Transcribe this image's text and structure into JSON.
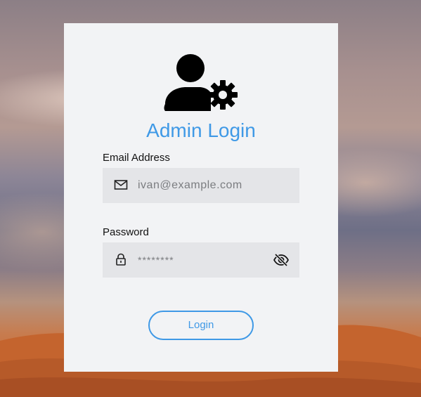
{
  "login": {
    "title": "Admin Login",
    "header_icon": "admin-user-gear-icon",
    "email": {
      "label": "Email Address",
      "value": "ivan@example.com",
      "icon": "envelope-icon"
    },
    "password": {
      "label": "Password",
      "value": "********",
      "icon": "lock-icon",
      "toggle_icon": "eye-slash-icon"
    },
    "submit_label": "Login"
  },
  "colors": {
    "accent": "#3f99e6",
    "card": "#f2f3f5",
    "field": "#e4e5e8"
  }
}
